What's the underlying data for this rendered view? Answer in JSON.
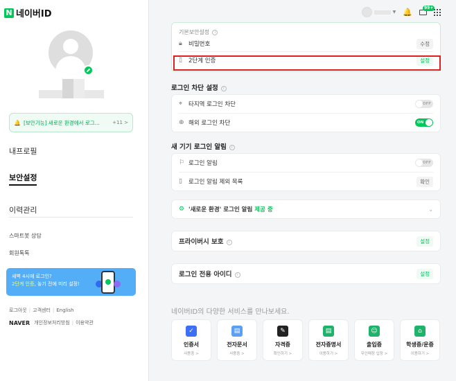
{
  "brand": {
    "logo_letter": "N",
    "title": "네이버ID"
  },
  "topbar": {
    "mail_badge": "99+"
  },
  "profile": {},
  "notice": {
    "text": "[보안기능] 새로운 환경에서 로그...",
    "count": "+11 >"
  },
  "nav": {
    "items": [
      {
        "label": "내프로필"
      },
      {
        "label": "보안설정"
      },
      {
        "label": "이력관리"
      }
    ],
    "sub_items": [
      {
        "label": "스마트봇 상담"
      },
      {
        "label": "회원톡톡"
      }
    ]
  },
  "banner": {
    "line1": "새벽 4시에 로그인?",
    "line2_highlight": "2단계 인증",
    "line2_rest": ", 놓기 전에 미리 설정!"
  },
  "footer": {
    "links": [
      "로그아웃",
      "고객센터",
      "English"
    ],
    "naver": "NAVER",
    "links2": [
      "개인정보처리방침",
      "이용약관"
    ]
  },
  "security": {
    "card_label": "기본보안설정",
    "password_label": "비밀번호",
    "password_button": "수정",
    "twostep_label": "2단계 인증",
    "twostep_button": "설정"
  },
  "block": {
    "title": "로그인 차단 설정",
    "foreign_region_label": "타지역 로그인 차단",
    "foreign_region_state": "OFF",
    "overseas_label": "해외 로그인 차단",
    "overseas_state": "ON"
  },
  "device_alert": {
    "title": "새 기기 로그인 알림",
    "login_alert_label": "로그인 알림",
    "login_alert_state": "OFF",
    "exclude_label": "로그인 알림 제외 목록",
    "exclude_button": "확인"
  },
  "new_env": {
    "label": "'새로운 환경' 로그인 알림",
    "status": "제공 중"
  },
  "privacy": {
    "label": "프라이버시 보호",
    "button": "설정"
  },
  "login_only_id": {
    "label": "로그인 전용 아이디",
    "button": "설정"
  },
  "services": {
    "title": "네이버ID의 다양한 서비스를 만나보세요.",
    "items": [
      {
        "name": "인증서",
        "sub": "사용중 >",
        "color": "#3d6ff5",
        "icon": "shield-icon"
      },
      {
        "name": "전자문서",
        "sub": "사용중 >",
        "color": "#5aa0f5",
        "icon": "document-icon"
      },
      {
        "name": "자격증",
        "sub": "확인하기 >",
        "color": "#222222",
        "icon": "certificate-icon"
      },
      {
        "name": "전자증명서",
        "sub": "이용하기 >",
        "color": "#1fb26b",
        "icon": "e-certificate-icon"
      },
      {
        "name": "출입증",
        "sub": "무인매장 입장 >",
        "color": "#1fb26b",
        "icon": "badge-icon"
      },
      {
        "name": "학생증/운증",
        "sub": "이용하기 >",
        "color": "#1fb26b",
        "icon": "building-icon"
      }
    ]
  }
}
